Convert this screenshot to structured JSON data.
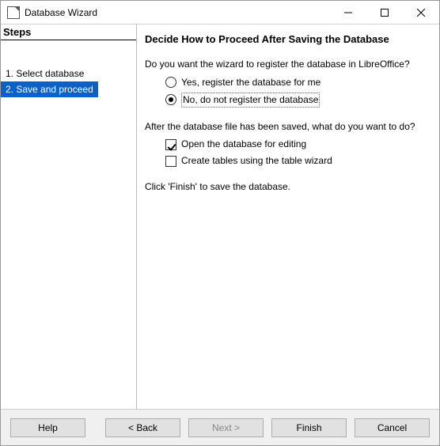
{
  "window": {
    "title": "Database Wizard"
  },
  "sidebar": {
    "header": "Steps",
    "items": [
      {
        "label": "1. Select database",
        "selected": false
      },
      {
        "label": "2. Save and proceed",
        "selected": true
      }
    ]
  },
  "content": {
    "heading": "Decide How to Proceed After Saving the Database",
    "registerQuestion": "Do you want the wizard to register the database in LibreOffice?",
    "registerOptions": {
      "yes": "Yes, register the database for me",
      "no": "No, do not register the database"
    },
    "afterSaveQuestion": "After the database file has been saved, what do you want to do?",
    "afterSaveOptions": {
      "openForEdit": "Open the database for editing",
      "createTables": "Create tables using the table wizard"
    },
    "finishHint": "Click 'Finish' to save the database."
  },
  "buttons": {
    "help": "Help",
    "back": "< Back",
    "next": "Next >",
    "finish": "Finish",
    "cancel": "Cancel"
  }
}
